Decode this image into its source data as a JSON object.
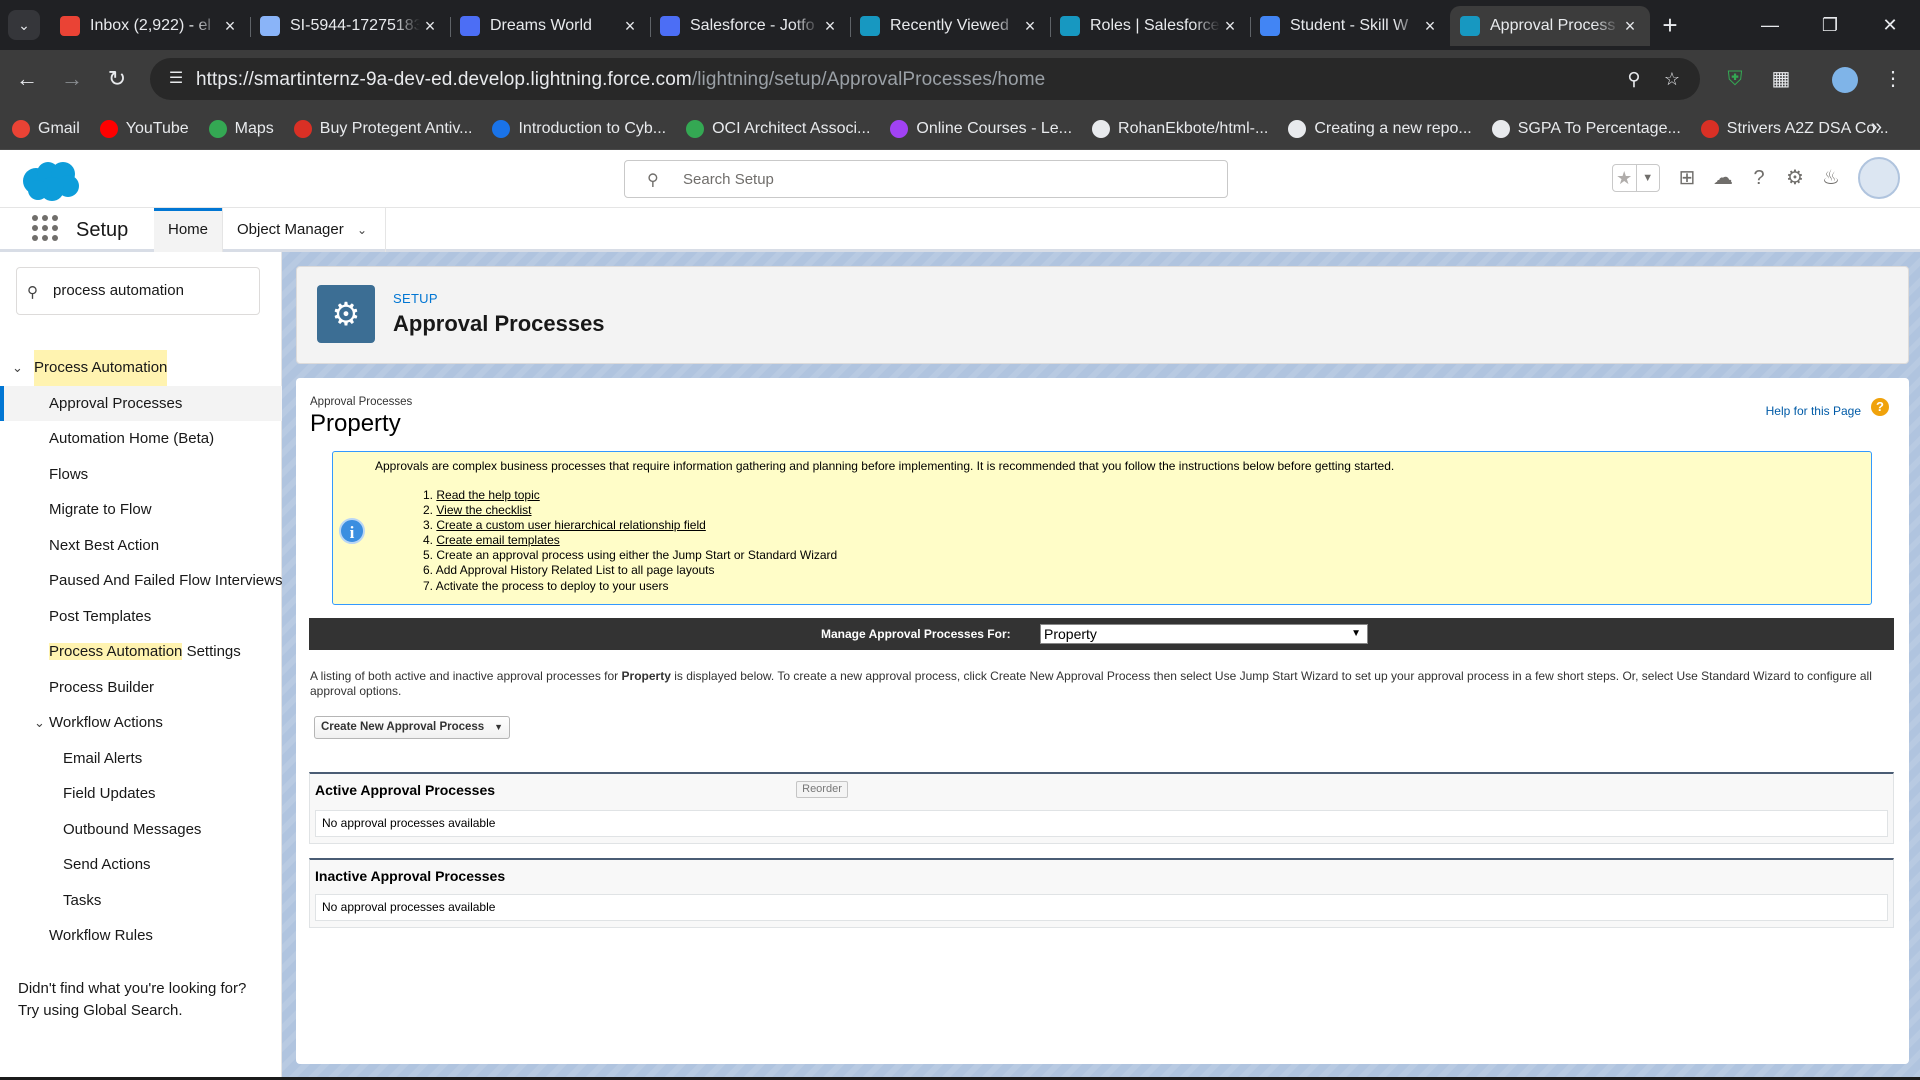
{
  "browser": {
    "tabs": [
      {
        "title": "Inbox (2,922) - el",
        "icon": "gmail-icon",
        "color": "#ea4335",
        "active": false
      },
      {
        "title": "SI-5944-17275183",
        "icon": "form-icon",
        "color": "#8ab4f8",
        "active": false
      },
      {
        "title": "Dreams World",
        "icon": "jotform-icon",
        "color": "#4c6ef5",
        "active": false
      },
      {
        "title": "Salesforce - Jotfo",
        "icon": "jotform-icon",
        "color": "#4c6ef5",
        "active": false
      },
      {
        "title": "Recently Viewed",
        "icon": "salesforce-icon",
        "color": "#1798c1",
        "active": false
      },
      {
        "title": "Roles | Salesforce",
        "icon": "salesforce-icon",
        "color": "#1798c1",
        "active": false
      },
      {
        "title": "Student - Skill W",
        "icon": "skillwallet-icon",
        "color": "#4285f4",
        "active": false
      },
      {
        "title": "Approval Process",
        "icon": "salesforce-icon",
        "color": "#1798c1",
        "active": true
      }
    ],
    "url_host": "https://smartinternz-9a-dev-ed.develop.lightning.force.com",
    "url_path": "/lightning/setup/ApprovalProcesses/home",
    "bookmarks": [
      {
        "label": "Gmail",
        "color": "#ea4335"
      },
      {
        "label": "YouTube",
        "color": "#ff0000"
      },
      {
        "label": "Maps",
        "color": "#34a853"
      },
      {
        "label": "Buy Protegent Antiv...",
        "color": "#d93025"
      },
      {
        "label": "Introduction to Cyb...",
        "color": "#1a73e8"
      },
      {
        "label": "OCI Architect Associ...",
        "color": "#34a853"
      },
      {
        "label": "Online Courses - Le...",
        "color": "#a142f4"
      },
      {
        "label": "RohanEkbote/html-...",
        "color": "#e8eaed"
      },
      {
        "label": "Creating a new repo...",
        "color": "#e8eaed"
      },
      {
        "label": "SGPA To Percentage...",
        "color": "#e8eaed"
      },
      {
        "label": "Strivers A2Z DSA Co...",
        "color": "#d93025"
      }
    ]
  },
  "sf": {
    "search_placeholder": "Search Setup",
    "app_name": "Setup",
    "tab_home": "Home",
    "tab_object_manager": "Object Manager"
  },
  "sidebar": {
    "quick_find_value": "process automation",
    "section": "Process Automation",
    "items": [
      {
        "label": "Approval Processes"
      },
      {
        "label": "Automation Home (Beta)"
      },
      {
        "label": "Flows"
      },
      {
        "label": "Migrate to Flow"
      },
      {
        "label": "Next Best Action"
      },
      {
        "label": "Paused And Failed Flow Interviews"
      },
      {
        "label": "Post Templates"
      },
      {
        "label_hl": "Process Automation",
        "label_rest": " Settings"
      },
      {
        "label": "Process Builder"
      },
      {
        "label": "Workflow Actions"
      },
      {
        "label": "Email Alerts"
      },
      {
        "label": "Field Updates"
      },
      {
        "label": "Outbound Messages"
      },
      {
        "label": "Send Actions"
      },
      {
        "label": "Tasks"
      },
      {
        "label": "Workflow Rules"
      }
    ],
    "footer_line1": "Didn't find what you're looking for?",
    "footer_line2": "Try using Global Search."
  },
  "page_header": {
    "eyebrow": "SETUP",
    "title": "Approval Processes"
  },
  "main": {
    "eyebrow": "Approval Processes",
    "title": "Property",
    "help_link": "Help for this Page",
    "info_intro": "Approvals are complex business processes that require information gathering and planning before implementing. It is recommended that you follow the instructions below before getting started.",
    "info_steps": [
      {
        "num": "1.",
        "text": "Read the help topic",
        "link": true
      },
      {
        "num": "2.",
        "text": "View the checklist",
        "link": true
      },
      {
        "num": "3.",
        "text": "Create a custom user hierarchical relationship field",
        "link": true
      },
      {
        "num": "4.",
        "text": "Create email templates",
        "link": true
      },
      {
        "num": "5.",
        "text": "Create an approval process using either the Jump Start or Standard Wizard",
        "link": false
      },
      {
        "num": "6.",
        "text": "Add Approval History Related List to all page layouts",
        "link": false
      },
      {
        "num": "7.",
        "text": "Activate the process to deploy to your users",
        "link": false
      }
    ],
    "manage_label": "Manage Approval Processes For:",
    "manage_value": "Property",
    "listing_desc_pre": "A listing of both active and inactive approval processes for ",
    "listing_desc_obj": "Property",
    "listing_desc_post": " is displayed below. To create a new approval process, click Create New Approval Process then select Use Jump Start Wizard to set up your approval process in a few short steps. Or, select Use Standard Wizard to configure all approval options.",
    "create_button": "Create New Approval Process",
    "active_title": "Active Approval Processes",
    "reorder_button": "Reorder",
    "active_empty": "No approval processes available",
    "inactive_title": "Inactive Approval Processes",
    "inactive_empty": "No approval processes available"
  }
}
